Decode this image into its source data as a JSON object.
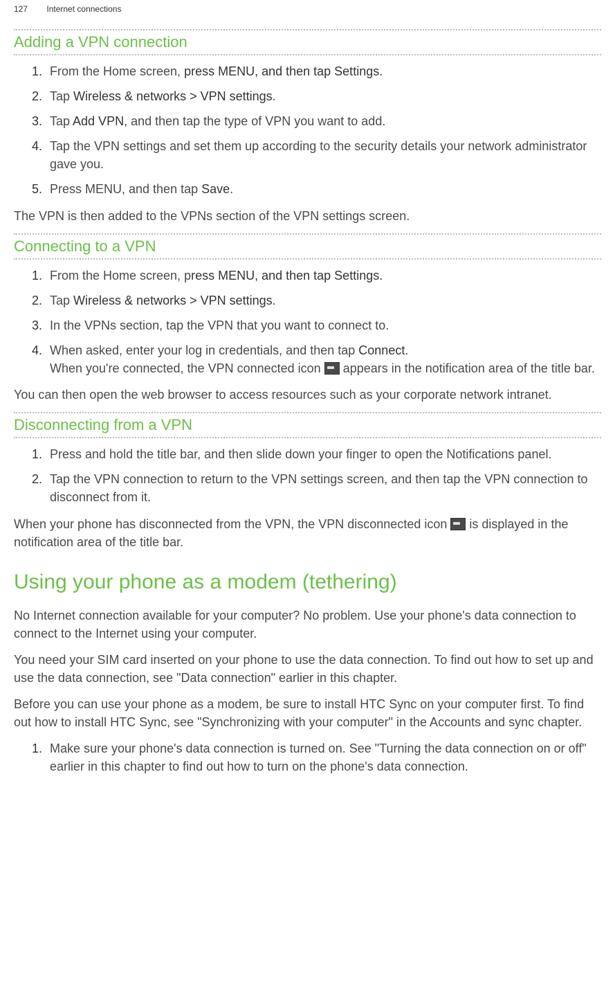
{
  "header": {
    "page_number": "127",
    "section": "Internet connections"
  },
  "s1": {
    "title": "Adding a VPN connection",
    "step1_a": "From the Home screen, ",
    "step1_b": "press MENU, and then tap Settings.",
    "step2_a": "Tap ",
    "step2_b": "Wireless & networks > VPN settings",
    "step2_c": ".",
    "step3_a": "Tap ",
    "step3_b": "Add VPN",
    "step3_c": ", and then tap the type of VPN you want to add.",
    "step4": "Tap the VPN settings and set them up according to the security details your network administrator gave you.",
    "step5_a": "Press MENU, and then tap ",
    "step5_b": "Save",
    "step5_c": ".",
    "after": "The VPN is then added to the VPNs section of the VPN settings screen."
  },
  "s2": {
    "title": "Connecting to a VPN",
    "step1_a": "From the Home screen, p",
    "step1_b": "ress MENU, and then tap Settings.",
    "step2_a": "Tap ",
    "step2_b": "Wireless & networks > VPN settings",
    "step2_c": ".",
    "step3": "In the VPNs section, tap the VPN that you want to connect to.",
    "step4_a": "When asked, enter your log in credentials, and then tap ",
    "step4_b": "Connect",
    "step4_c": ".",
    "step4_line2_a": "When you're connected, the VPN connected icon ",
    "step4_line2_b": " appears in the notification area of the title bar.",
    "after": "You can then open the web browser to access resources such as your corporate network intranet."
  },
  "s3": {
    "title": "Disconnecting from a VPN",
    "step1": "Press and hold the title bar, and then slide down your finger to open the Notifications panel.",
    "step2": "Tap the VPN connection to return to the VPN settings screen, and then tap the VPN connection to disconnect from it.",
    "after_a": "When your phone has disconnected from the VPN, the VPN disconnected icon ",
    "after_b": " is displayed in the notification area of the title bar."
  },
  "s4": {
    "title": "Using your phone as a modem (tethering)",
    "p1": "No Internet connection available for your computer? No problem. Use your phone's data connection to connect to the Internet using your computer.",
    "p2": "You need your SIM card inserted on your phone to use the data connection. To find out how to set up and use the data connection, see \"Data connection\" earlier in this chapter.",
    "p3": "Before you can use your phone as a modem, be sure to install HTC Sync on your computer first. To find out how to install HTC Sync, see \"Synchronizing with your computer\" in the Accounts and sync chapter.",
    "step1": "Make sure your phone's data connection is turned on. See \"Turning the data connection on or off\" earlier in this chapter to find out how to turn on the phone's data connection."
  }
}
